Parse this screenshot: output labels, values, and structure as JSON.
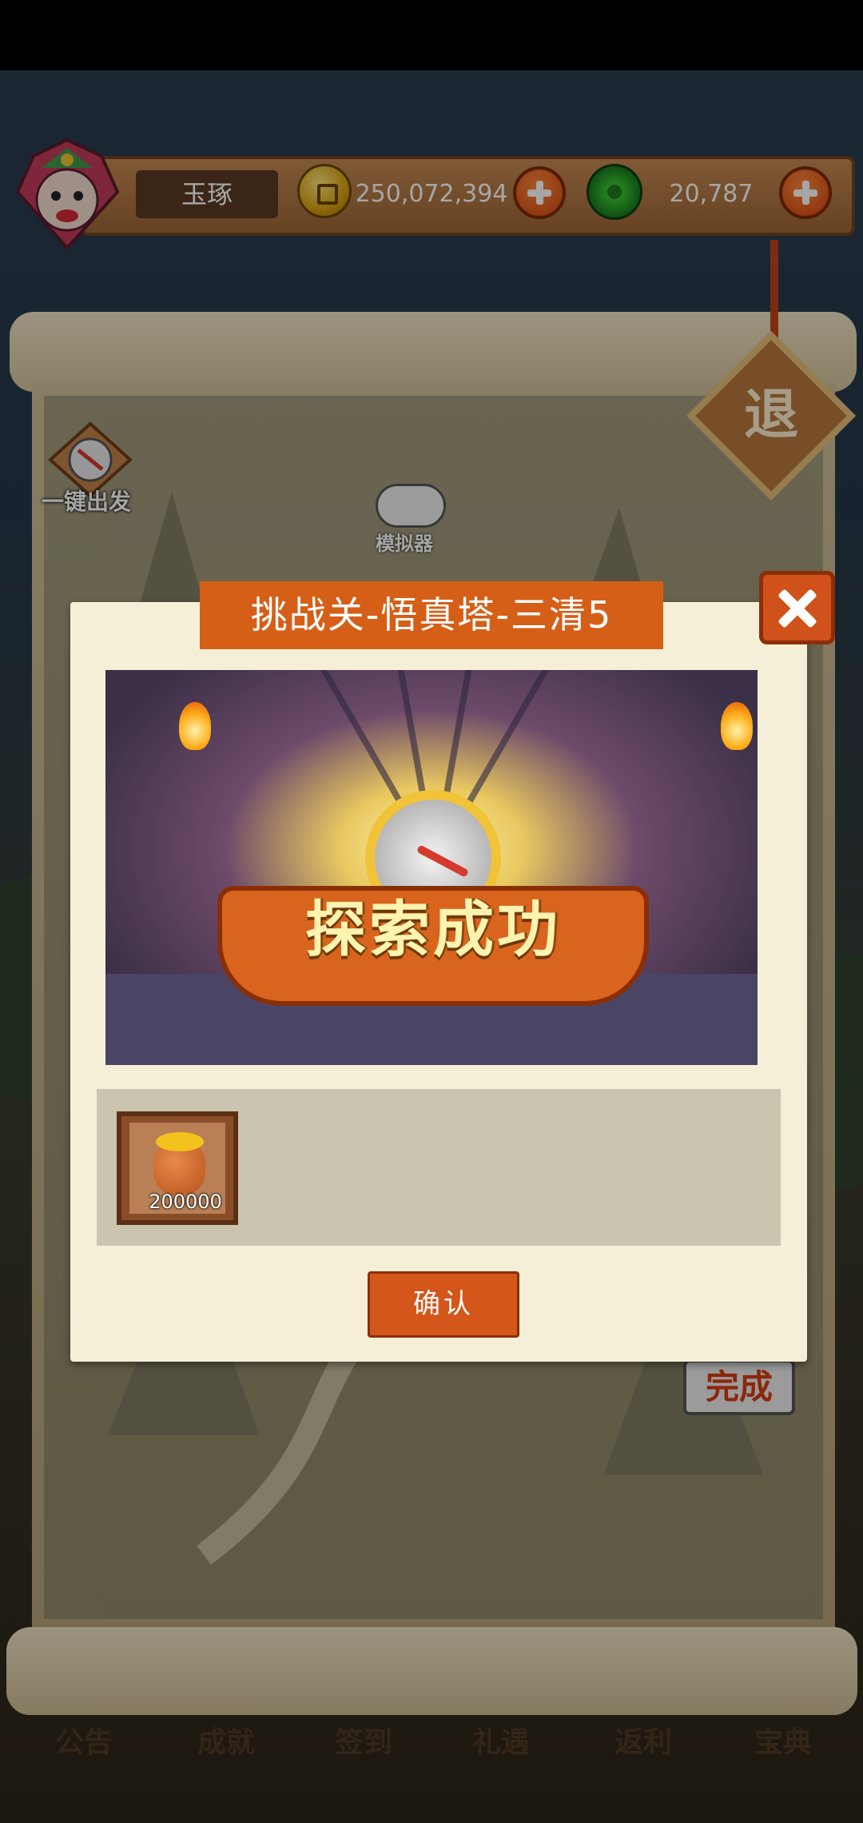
{
  "header": {
    "player_name": "玉琢",
    "coins": "250,072,394",
    "jade": "20,787"
  },
  "map": {
    "auto_depart_label": "一键出发",
    "simulator_label": "模拟器",
    "exit_label": "退",
    "complete_badge": "完成"
  },
  "nav": {
    "items": [
      "公告",
      "成就",
      "签到",
      "礼遇",
      "返利",
      "宝典"
    ]
  },
  "dialog": {
    "title": "挑战关-悟真塔-三清5",
    "banner_text": "探索成功",
    "reward": {
      "icon": "gold-bag-icon",
      "quantity": "200000"
    },
    "confirm_label": "确认"
  },
  "colors": {
    "accent_orange": "#d65f18",
    "dialog_bg": "#f6efd7",
    "reward_bg": "#cbc4ae"
  }
}
